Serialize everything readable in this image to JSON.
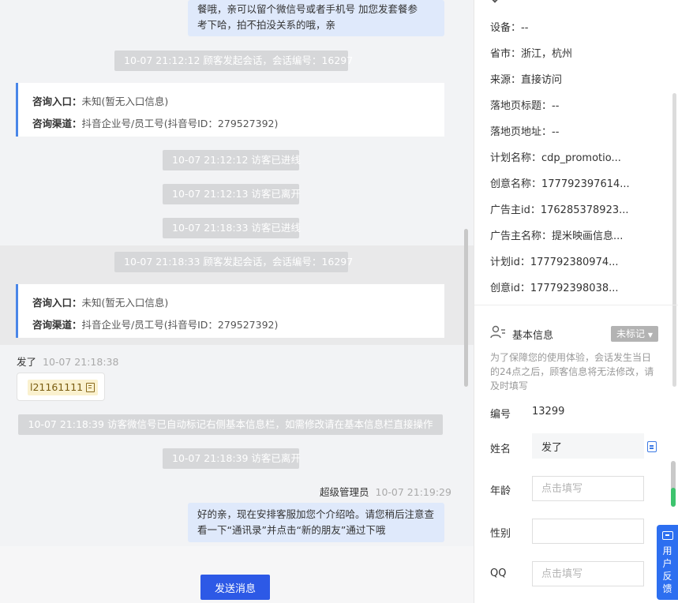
{
  "chat": {
    "agent_msg_1": [
      "餐哦，亲可以留个微信号或者手机号 加您发套餐参",
      "考下哈，拍不拍没关系的哦，亲"
    ],
    "sys_session_1": "10-07 21:12:12 顾客发起会话，会话编号：16297",
    "card_1": {
      "entry_label": "咨询入口：",
      "entry_value": "未知(暂无入口信息)",
      "channel_label": "咨询渠道：",
      "channel_value": "抖音企业号/员工号(抖音号ID：279527392)"
    },
    "sys_online_1": "10-07 21:12:12 访客已进线",
    "sys_left_1": "10-07 21:12:13 访客已离开",
    "sys_online_2": "10-07 21:18:33 访客已进线",
    "sys_session_2": "10-07 21:18:33 顾客发起会话，会话编号：16297",
    "card_2": {
      "entry_label": "咨询入口：",
      "entry_value": "未知(暂无入口信息)",
      "channel_label": "咨询渠道：",
      "channel_value": "抖音企业号/员工号(抖音号ID：279527392)"
    },
    "visitor_name": "发了",
    "visitor_time": "10-07 21:18:38",
    "visitor_code": "l21161111",
    "sys_wechat": "10-07 21:18:39 访客微信号已自动标记右侧基本信息栏，如需修改请在基本信息栏直接操作",
    "sys_left_2": "10-07 21:18:39 访客已离开",
    "agent_name": "超级管理员",
    "agent_time": "10-07 21:19:29",
    "agent_msg_2": [
      "好的亲，现在安排客服加您个介绍哈。请您稍后注意查",
      "看一下“通讯录”并点击“新的朋友”通过下哦"
    ],
    "send_label": "发送消息"
  },
  "panel": {
    "info_rows": [
      "设备：--",
      "省市：浙江，杭州",
      "来源：直接访问",
      "落地页标题：--",
      "落地页地址：--",
      "计划名称：cdp_promotio...",
      "创意名称：177792397614...",
      "广告主id：176285378923...",
      "广告主名称：提米映画信息...",
      "计划id：177792380974...",
      "创意id：177792398038..."
    ],
    "section_title": "基本信息",
    "tag_label": "未标记",
    "hint": "为了保障您的使用体验，会话发生当日的24点之后，顾客信息将无法修改，请及时填写",
    "id_label": "编号",
    "id_value": "13299",
    "name_label": "姓名",
    "name_value": "发了",
    "age_label": "年龄",
    "age_placeholder": "点击填写",
    "gender_label": "性别",
    "qq_label": "QQ",
    "qq_placeholder": "点击填写",
    "feedback": "用户反馈"
  }
}
